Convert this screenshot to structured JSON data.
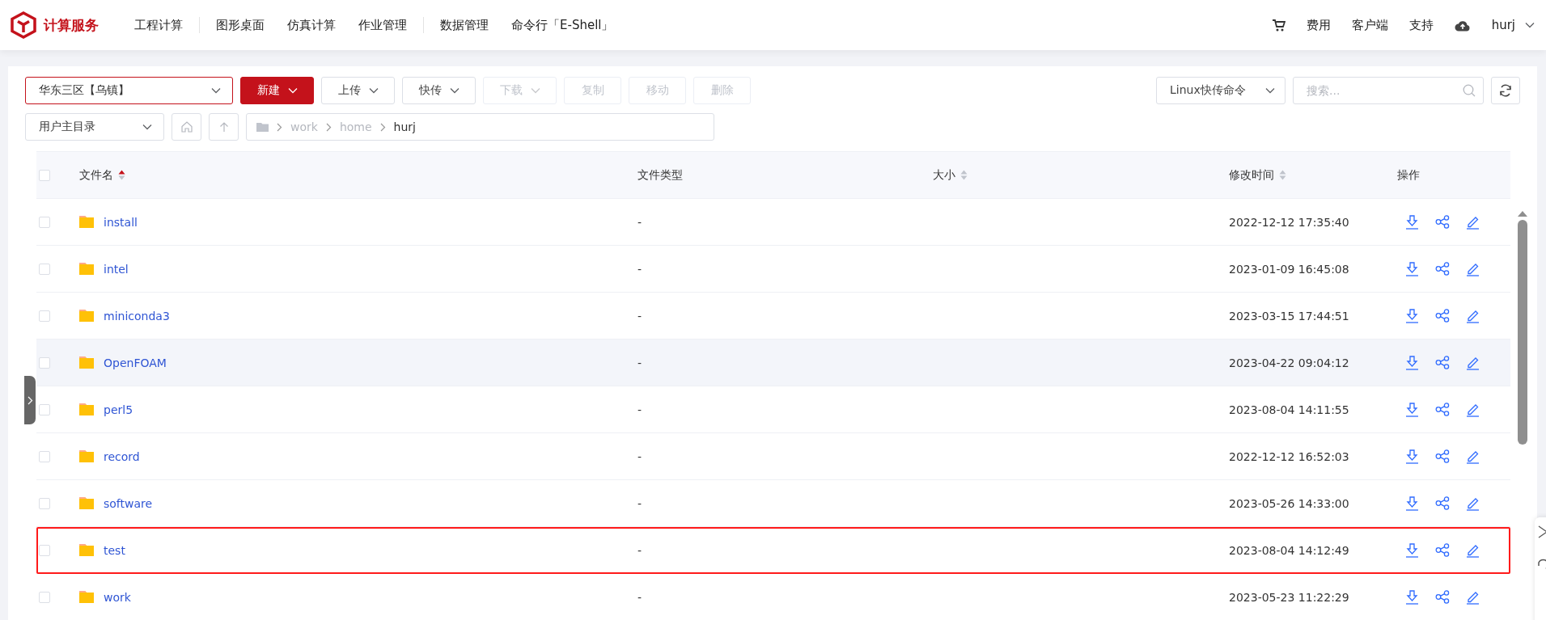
{
  "header": {
    "brand": "计算服务",
    "nav": [
      {
        "kind": "link",
        "label": "工程计算"
      },
      {
        "kind": "divider"
      },
      {
        "kind": "link",
        "label": "图形桌面"
      },
      {
        "kind": "link",
        "label": "仿真计算"
      },
      {
        "kind": "link",
        "label": "作业管理"
      },
      {
        "kind": "divider"
      },
      {
        "kind": "link",
        "label": "数据管理"
      },
      {
        "kind": "link",
        "label": "命令行「E-Shell」"
      }
    ],
    "links": [
      "费用",
      "客户端",
      "支持"
    ],
    "user": "hurj"
  },
  "toolbar": {
    "region": "华东三区【乌镇】",
    "buttons": [
      {
        "label": "新建",
        "kind": "primary",
        "dropdown": true,
        "disabled": false
      },
      {
        "label": "上传",
        "kind": "default",
        "dropdown": true,
        "disabled": false
      },
      {
        "label": "快传",
        "kind": "default",
        "dropdown": true,
        "disabled": false
      },
      {
        "label": "下载",
        "kind": "default",
        "dropdown": true,
        "disabled": true
      },
      {
        "label": "复制",
        "kind": "default",
        "dropdown": false,
        "disabled": true
      },
      {
        "label": "移动",
        "kind": "default",
        "dropdown": false,
        "disabled": true
      },
      {
        "label": "删除",
        "kind": "default",
        "dropdown": false,
        "disabled": true
      }
    ],
    "command_menu": "Linux快传命令",
    "search": {
      "placeholder": "搜索..."
    },
    "directory": "用户主目录",
    "path": [
      {
        "label": "work",
        "current": false
      },
      {
        "label": "home",
        "current": false
      },
      {
        "label": "hurj",
        "current": true
      }
    ]
  },
  "table": {
    "all_checked": false,
    "columns": [
      {
        "label": "文件名",
        "sortable": true,
        "sorted_ascending": true
      },
      {
        "label": "文件类型",
        "sortable": false
      },
      {
        "label": "大小",
        "sortable": true,
        "sorted_ascending": false
      },
      {
        "label": "修改时间",
        "sortable": true,
        "sorted_ascending": false
      },
      {
        "label": "操作",
        "sortable": false
      }
    ],
    "rows": [
      {
        "name": "install",
        "type": "-",
        "modified": "2022-12-12 17:35:40",
        "checked": false,
        "hovered": false,
        "highlighted": false
      },
      {
        "name": "intel",
        "type": "-",
        "modified": "2023-01-09 16:45:08",
        "checked": false,
        "hovered": false,
        "highlighted": false
      },
      {
        "name": "miniconda3",
        "type": "-",
        "modified": "2023-03-15 17:44:51",
        "checked": false,
        "hovered": false,
        "highlighted": false
      },
      {
        "name": "OpenFOAM",
        "type": "-",
        "modified": "2023-04-22 09:04:12",
        "checked": false,
        "hovered": true,
        "highlighted": false
      },
      {
        "name": "perl5",
        "type": "-",
        "modified": "2023-08-04 14:11:55",
        "checked": false,
        "hovered": false,
        "highlighted": false
      },
      {
        "name": "record",
        "type": "-",
        "modified": "2022-12-12 16:52:03",
        "checked": false,
        "hovered": false,
        "highlighted": false
      },
      {
        "name": "software",
        "type": "-",
        "modified": "2023-05-26 14:33:00",
        "checked": false,
        "hovered": false,
        "highlighted": false
      },
      {
        "name": "test",
        "type": "-",
        "modified": "2023-08-04 14:12:49",
        "checked": false,
        "hovered": false,
        "highlighted": true
      },
      {
        "name": "work",
        "type": "-",
        "modified": "2023-05-23 11:22:29",
        "checked": false,
        "hovered": false,
        "highlighted": false
      }
    ]
  }
}
